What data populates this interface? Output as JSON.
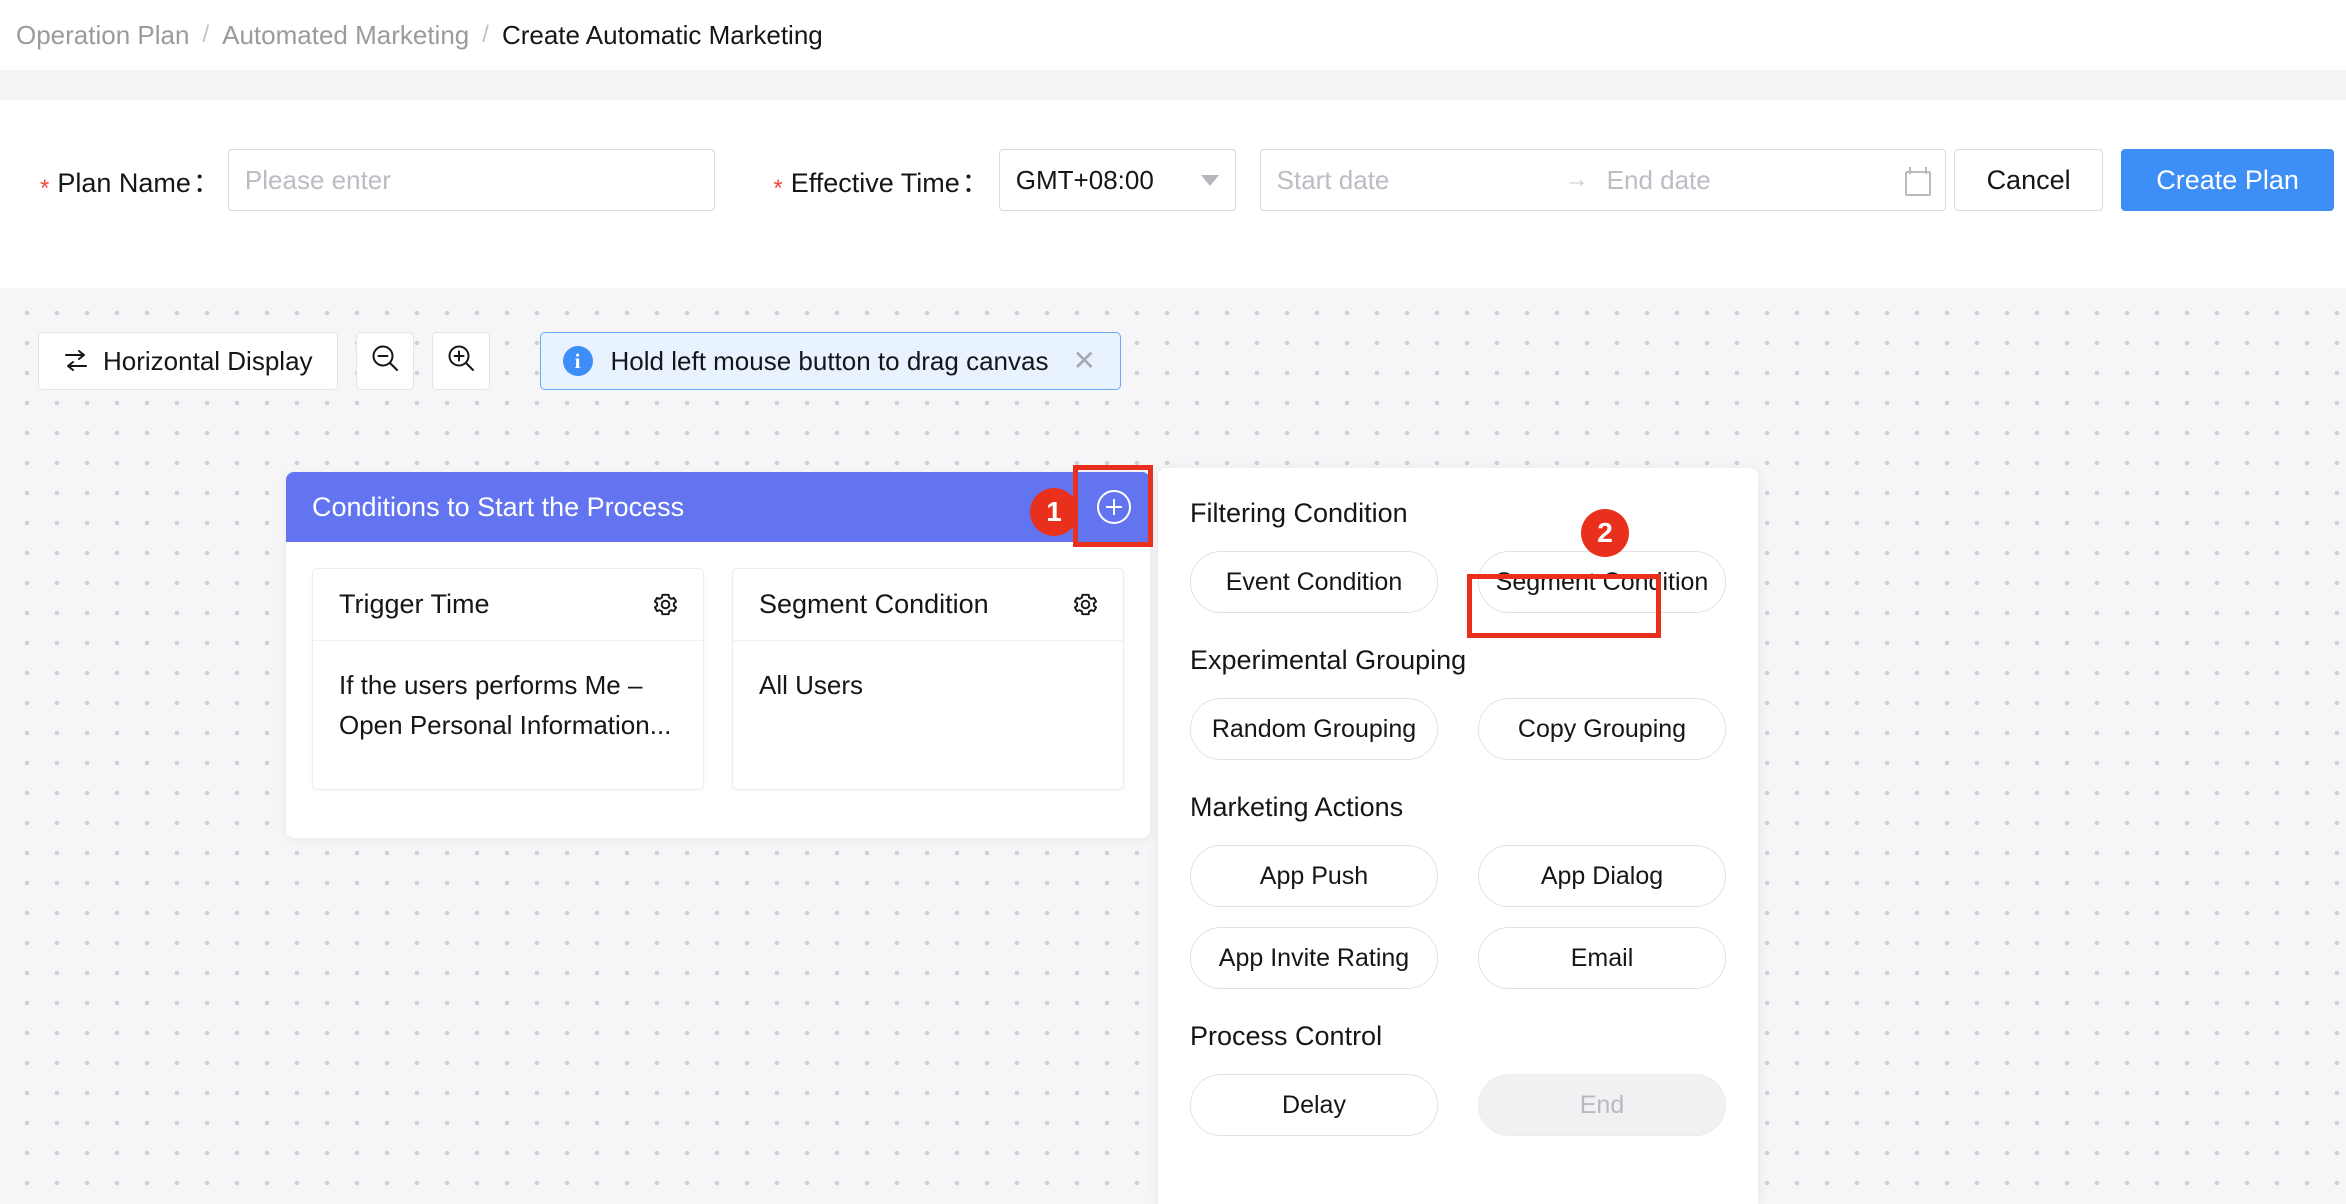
{
  "breadcrumb": {
    "items": [
      {
        "label": "Operation Plan",
        "current": false
      },
      {
        "label": "Automated Marketing",
        "current": false
      },
      {
        "label": "Create Automatic Marketing",
        "current": true
      }
    ],
    "separator": "/"
  },
  "form": {
    "plan_name_label": "Plan Name",
    "plan_name_colon": "：",
    "plan_name_value": "",
    "plan_name_placeholder": "Please enter",
    "effective_time_label": "Effective Time",
    "effective_time_colon": "：",
    "timezone_value": "GMT+08:00",
    "start_date_placeholder": "Start date",
    "range_arrow": "→",
    "end_date_placeholder": "End date",
    "cancel_label": "Cancel",
    "create_label": "Create Plan",
    "required_mark": "*",
    "accent_primary": "#3d8ef7",
    "required_color": "#f5483b"
  },
  "toolbar": {
    "layout_toggle_label": "Horizontal Display",
    "zoom_out_label": "",
    "zoom_in_label": "",
    "tip_icon_label": "i",
    "tip_text": "Hold left mouse button to drag canvas",
    "tip_close_label": "✕"
  },
  "flow_node": {
    "title": "Conditions to Start the Process",
    "header_color": "#6274ef",
    "cards": [
      {
        "title": "Trigger Time",
        "body": "If the users performs Me – Open Personal Information..."
      },
      {
        "title": "Segment Condition",
        "body": "All Users"
      }
    ]
  },
  "right_panel": {
    "sections": [
      {
        "title": "Filtering Condition",
        "chips": [
          {
            "label": "Event Condition",
            "disabled": false
          },
          {
            "label": "Segment Condition",
            "disabled": false
          }
        ]
      },
      {
        "title": "Experimental Grouping",
        "chips": [
          {
            "label": "Random Grouping",
            "disabled": false
          },
          {
            "label": "Copy Grouping",
            "disabled": false
          }
        ]
      },
      {
        "title": "Marketing Actions",
        "chips": [
          {
            "label": "App Push",
            "disabled": false
          },
          {
            "label": "App Dialog",
            "disabled": false
          },
          {
            "label": "App Invite Rating",
            "disabled": false
          },
          {
            "label": "Email",
            "disabled": false
          }
        ]
      },
      {
        "title": "Process Control",
        "chips": [
          {
            "label": "Delay",
            "disabled": false
          },
          {
            "label": "End",
            "disabled": true
          }
        ]
      }
    ]
  },
  "annotations": {
    "color": "#e8301c",
    "steps": [
      {
        "number": "1",
        "target": "node-add-button"
      },
      {
        "number": "2",
        "target": "segment-condition-chip"
      }
    ]
  }
}
